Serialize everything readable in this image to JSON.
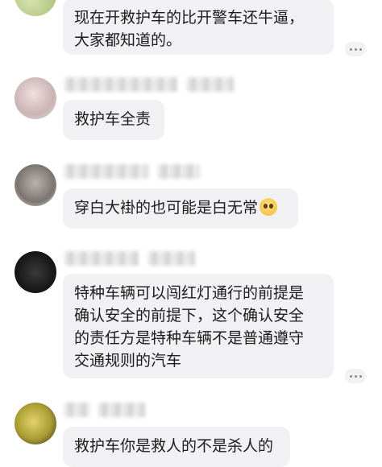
{
  "comments": [
    {
      "text_lines": [
        "现在开救护车的比开警车还牛逼，",
        "大家都知道的。"
      ]
    },
    {
      "text_lines": [
        "救护车全责"
      ]
    },
    {
      "text_lines": [
        "穿白大褂的也可能是白无常"
      ],
      "emoji": "pleading-face-emoji"
    },
    {
      "text_lines": [
        "特种车辆可以闯红灯通行的前提是",
        "确认安全的前提下，这个确认安全",
        "的责任方是特种车辆不是普通遵守",
        "交通规则的汽车"
      ]
    },
    {
      "text_lines": [
        "救护车你是救人的不是杀人的"
      ]
    }
  ],
  "icons": {
    "more": "more-dots-icon"
  },
  "colors": {
    "bubble_bg": "#f1f1f3",
    "text": "#1c1c1c"
  }
}
